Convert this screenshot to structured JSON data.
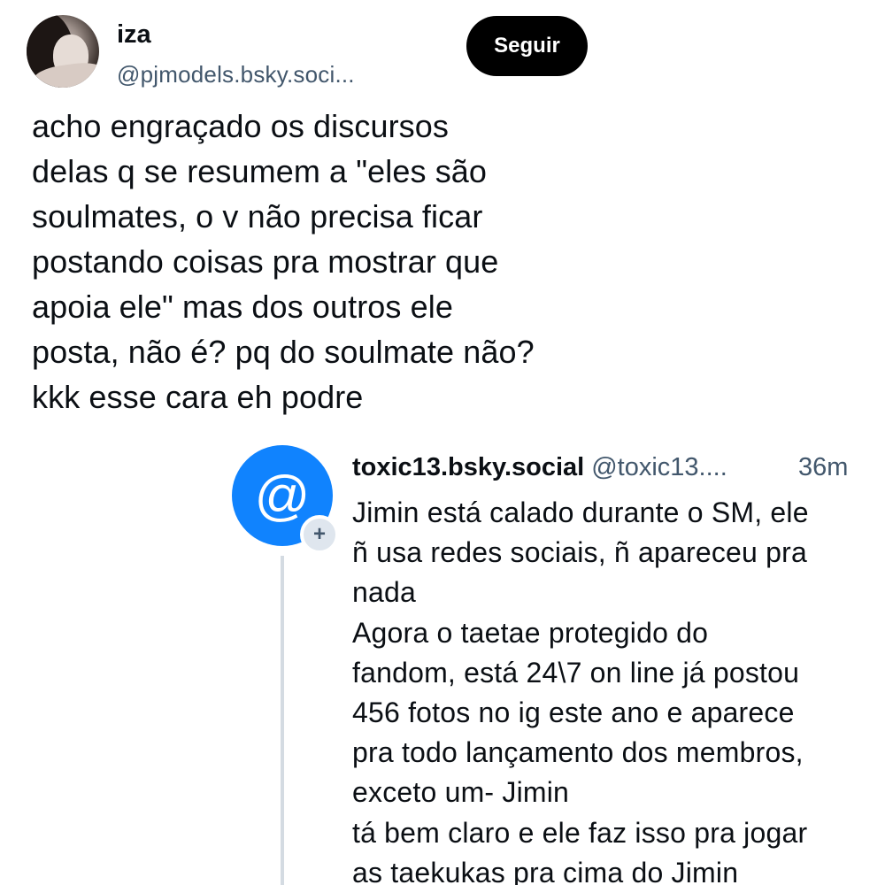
{
  "author": {
    "display_name": "iza",
    "handle": "@pjmodels.bsky.soci...",
    "follow_label": "Seguir"
  },
  "post": {
    "text": "acho engraçado os discursos\ndelas q se resumem a \"eles são\nsoulmates, o v não precisa ficar\npostando coisas pra mostrar que\napoia ele\" mas dos outros ele\nposta, não é? pq do soulmate não?\nkkk esse cara eh podre"
  },
  "reply": {
    "avatar_symbol": "@",
    "badge_symbol": "+",
    "display_name": "toxic13.bsky.social",
    "handle": "@toxic13....",
    "time": "36m",
    "text": "Jimin está calado durante o SM, ele\nñ usa redes sociais, ñ apareceu pra\nnada\nAgora o taetae  protegido do\nfandom, está 24\\7 on line já postou\n456 fotos no ig este ano e aparece\npra todo lançamento dos membros,\nexceto um- Jimin\ntá bem claro e ele faz isso pra jogar\nas taekukas pra cima do Jimin"
  },
  "colors": {
    "text_primary": "#0b0f14",
    "text_secondary": "#42576c",
    "follow_button_bg": "#000000",
    "reply_avatar_bg": "#1083fe",
    "thread_line": "#d4dbe2"
  },
  "icons": {
    "reply_avatar": "at-sign-icon",
    "follow_badge": "plus-icon"
  }
}
